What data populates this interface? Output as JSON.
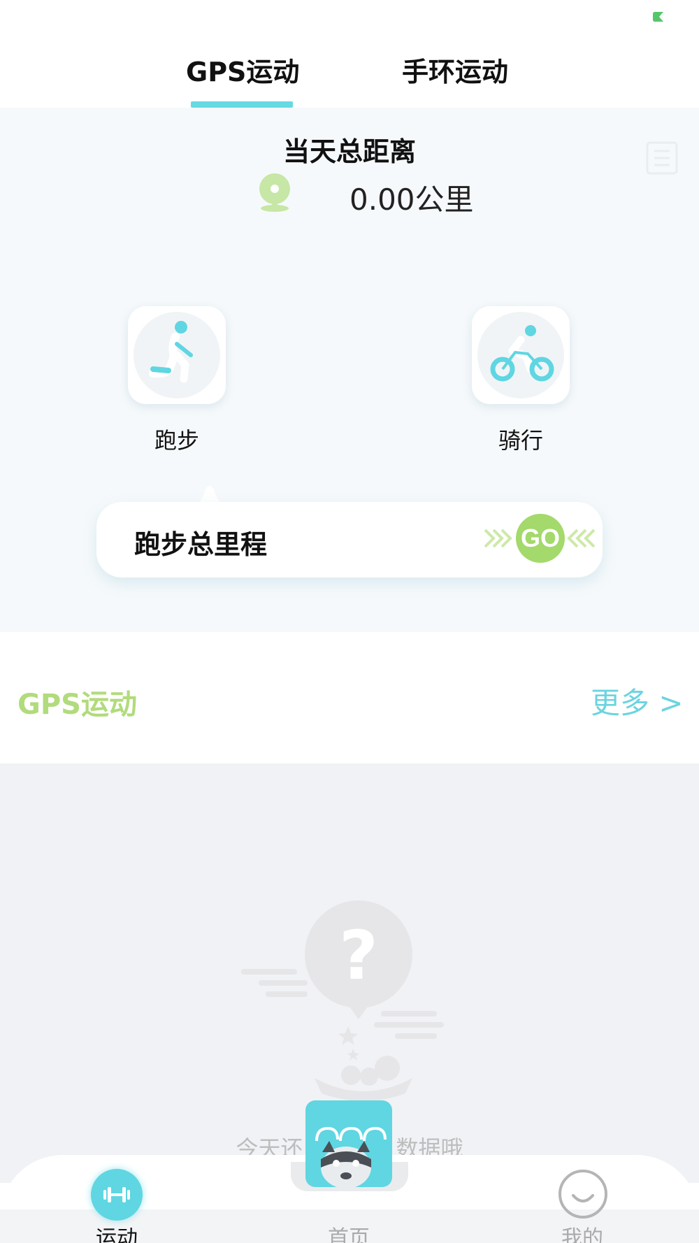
{
  "tabs": [
    {
      "label": "GPS运动",
      "active": true
    },
    {
      "label": "手环运动",
      "active": false
    }
  ],
  "daily": {
    "title": "当天总距离",
    "distance": "0.00",
    "unit": "公里"
  },
  "sports": [
    {
      "label": "跑步",
      "icon": "running-icon"
    },
    {
      "label": "骑行",
      "icon": "cycling-icon"
    }
  ],
  "mileage": {
    "title": "跑步总里程",
    "go_label": "GO"
  },
  "section": {
    "title": "GPS运动",
    "more": "更多 >"
  },
  "empty": {
    "text_left": "今天还",
    "text_right": "数据哦"
  },
  "bottom_nav": [
    {
      "label": "运动",
      "icon": "dumbbell-icon",
      "active": true
    },
    {
      "label": "首页",
      "icon": "raccoon-logo-icon",
      "active": false
    },
    {
      "label": "我的",
      "icon": "smile-icon",
      "active": false
    }
  ],
  "colors": {
    "accent_cyan": "#5fd6e2",
    "accent_green": "#a4d96b",
    "section_green": "#b1db7c"
  }
}
